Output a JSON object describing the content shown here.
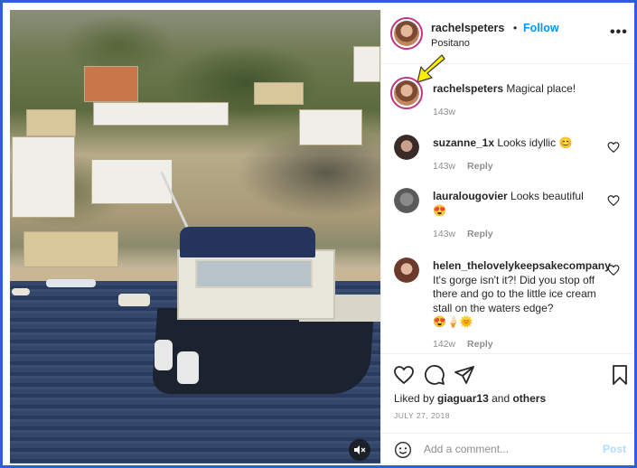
{
  "post": {
    "username": "rachelspeters",
    "separator": "•",
    "follow_label": "Follow",
    "location": "Positano",
    "more_label": "•••"
  },
  "caption": {
    "username": "rachelspeters",
    "text": "Magical place!",
    "age": "143w"
  },
  "comments": [
    {
      "username": "suzanne_1x",
      "text": "Looks idyllic",
      "emoji": "😊",
      "age": "143w",
      "reply_label": "Reply"
    },
    {
      "username": "lauralougovier",
      "text": "Looks beautiful",
      "emoji": "😍",
      "age": "143w",
      "reply_label": "Reply"
    },
    {
      "username": "helen_thelovelykeepsakecompany",
      "text": "It's gorge isn't it?! Did you stop off there and go to the little ice cream stall on the waters edge?",
      "emoji": "😍🍦🌞",
      "age": "142w",
      "reply_label": "Reply"
    }
  ],
  "actions": {
    "liked_prefix": "Liked by",
    "liked_user": "giaguar13",
    "liked_and": "and",
    "liked_others": "others",
    "date": "JULY 27, 2018"
  },
  "add_comment": {
    "placeholder": "Add a comment...",
    "post_label": "Post"
  },
  "colors": {
    "frame": "#2f5fd6",
    "follow": "#0095f6",
    "post_disabled": "#b3dbff",
    "annotation_arrow": "#ffee00"
  },
  "icons": [
    "volume-off-icon",
    "more-options-icon",
    "heart-icon",
    "comment-icon",
    "share-icon",
    "bookmark-icon",
    "emoji-icon",
    "annotation-arrow-icon"
  ]
}
